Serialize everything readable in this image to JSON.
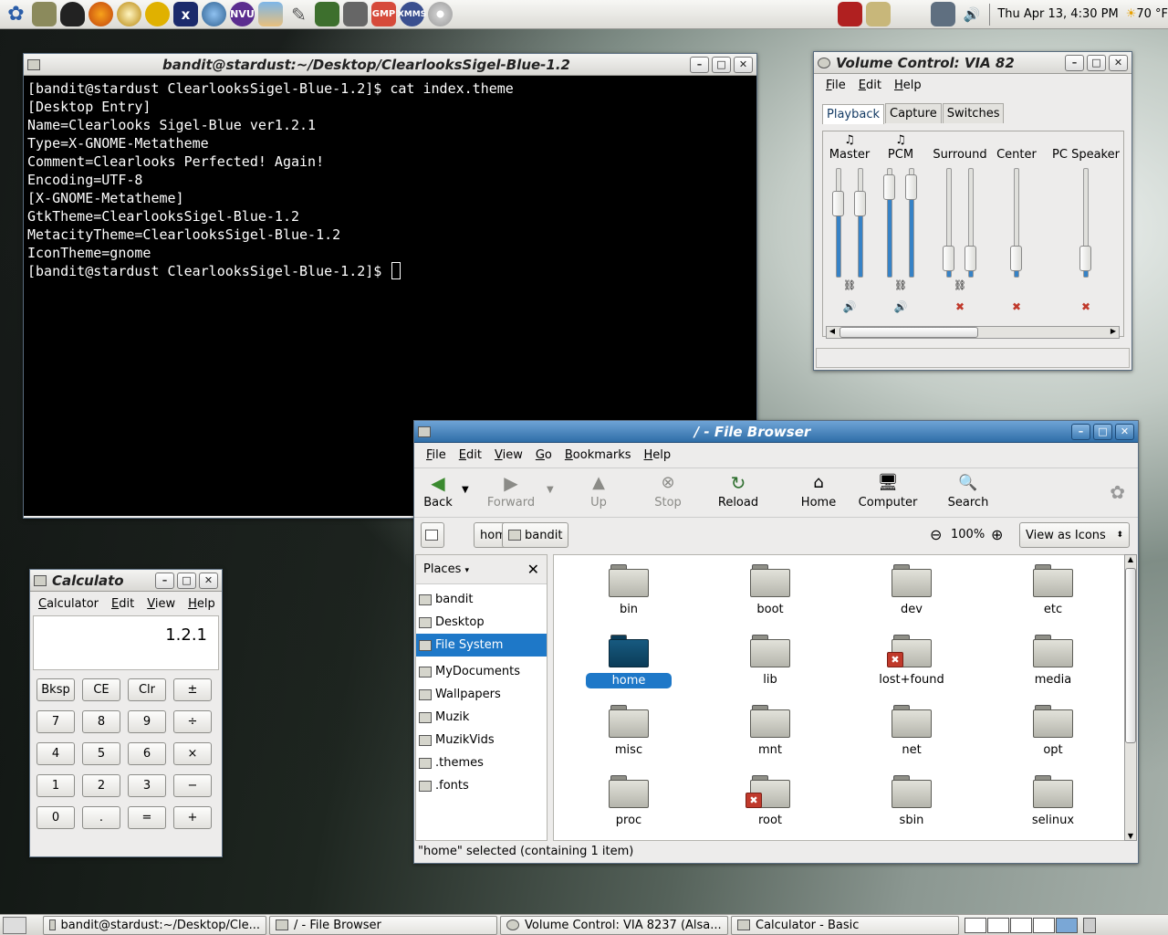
{
  "top_panel": {
    "clock": "Thu Apr 13,  4:30 PM",
    "temperature": "70 °F"
  },
  "terminal": {
    "title": "bandit@stardust:~/Desktop/ClearlooksSigel-Blue-1.2",
    "lines": [
      "[bandit@stardust ClearlooksSigel-Blue-1.2]$ cat index.theme",
      "[Desktop Entry]",
      "Name=Clearlooks Sigel-Blue ver1.2.1",
      "Type=X-GNOME-Metatheme",
      "Comment=Clearlooks Perfected! Again!",
      "Encoding=UTF-8",
      "",
      "[X-GNOME-Metatheme]",
      "GtkTheme=ClearlooksSigel-Blue-1.2",
      "MetacityTheme=ClearlooksSigel-Blue-1.2",
      "IconTheme=gnome",
      "[bandit@stardust ClearlooksSigel-Blue-1.2]$ "
    ]
  },
  "volume": {
    "title": "Volume Control: VIA 82",
    "menu": [
      "File",
      "Edit",
      "Help"
    ],
    "tabs": [
      "Playback",
      "Capture",
      "Switches"
    ],
    "channels": [
      {
        "name": "Master",
        "level_left": 0.75,
        "level_right": 0.75,
        "muted": false
      },
      {
        "name": "PCM",
        "level_left": 0.93,
        "level_right": 0.93,
        "muted": false
      },
      {
        "name": "Surround",
        "level_left": 0.15,
        "level_right": 0.15,
        "muted": true
      },
      {
        "name": "Center",
        "level_left": 0.15,
        "muted": true
      },
      {
        "name": "PC Speaker",
        "level_left": 0.15,
        "muted": true
      }
    ]
  },
  "filebrowser": {
    "title": "/ - File Browser",
    "menu": [
      "File",
      "Edit",
      "View",
      "Go",
      "Bookmarks",
      "Help"
    ],
    "toolbar": {
      "back": "Back",
      "forward": "Forward",
      "up": "Up",
      "stop": "Stop",
      "reload": "Reload",
      "home": "Home",
      "computer": "Computer",
      "search": "Search"
    },
    "path": [
      "home",
      "bandit"
    ],
    "zoom": "100%",
    "view_mode": "View as Icons",
    "places_label": "Places",
    "places": [
      "bandit",
      "Desktop",
      "File System",
      "MyDocuments",
      "Wallpapers",
      "Muzik",
      "MuzikVids",
      ".themes",
      ".fonts"
    ],
    "folders": [
      "bin",
      "boot",
      "dev",
      "etc",
      "home",
      "lib",
      "lost+found",
      "media",
      "misc",
      "mnt",
      "net",
      "opt",
      "proc",
      "root",
      "sbin",
      "selinux"
    ],
    "status": "\"home\" selected (containing 1 item)"
  },
  "calculator": {
    "title": "Calculato",
    "menu": [
      "Calculator",
      "Edit",
      "View",
      "Help"
    ],
    "display": "1.2.1",
    "buttons": [
      "Bksp",
      "CE",
      "Clr",
      "±",
      "7",
      "8",
      "9",
      "÷",
      "4",
      "5",
      "6",
      "×",
      "1",
      "2",
      "3",
      "−",
      "0",
      ".",
      "=",
      "+"
    ]
  },
  "taskbar": [
    "bandit@stardust:~/Desktop/Cle...",
    "/ - File Browser",
    "Volume Control: VIA 8237 (Alsa...",
    "Calculator  - Basic"
  ]
}
